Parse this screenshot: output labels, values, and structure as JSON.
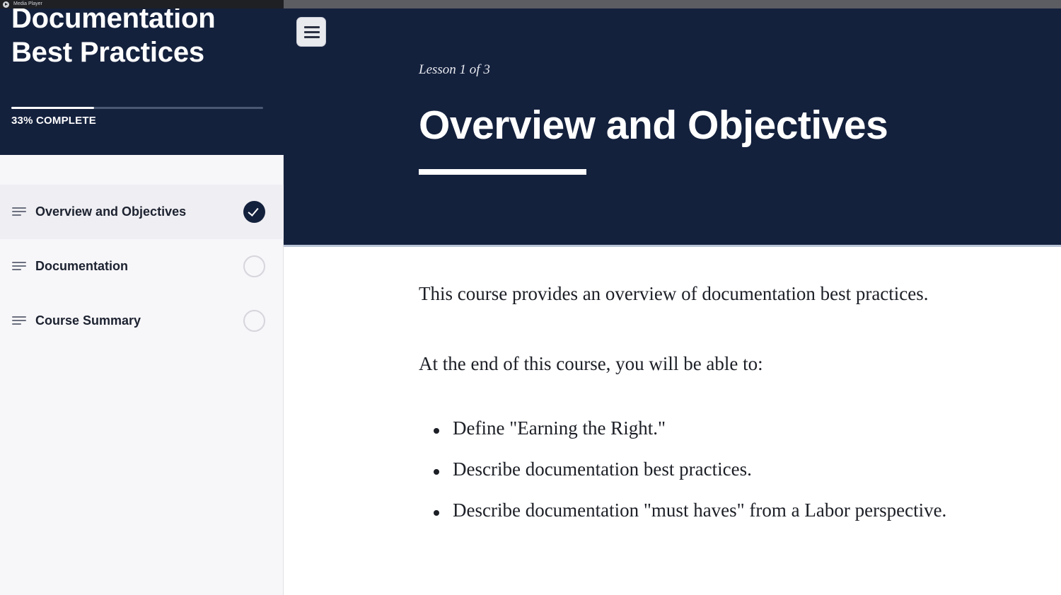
{
  "media_player": {
    "title": "Media Player"
  },
  "sidebar": {
    "course_title": "Documentation Best Practices",
    "progress": {
      "percent": 33,
      "label": "33% COMPLETE"
    },
    "lessons": [
      {
        "label": "Overview and Objectives",
        "status": "complete",
        "active": true
      },
      {
        "label": "Documentation",
        "status": "incomplete",
        "active": false
      },
      {
        "label": "Course Summary",
        "status": "incomplete",
        "active": false
      }
    ]
  },
  "main": {
    "menu_icon": "hamburger-icon",
    "lesson_counter": "Lesson 1 of 3",
    "lesson_title": "Overview and Objectives",
    "intro": "This course provides an overview of documentation best practices.",
    "lead": "At the end of this course, you will be able to:",
    "objectives": [
      "Define \"Earning the Right.\"",
      "Describe documentation best practices.",
      "Describe documentation \"must haves\" from a Labor perspective."
    ]
  },
  "colors": {
    "navy": "#14213d",
    "sidebar_bg": "#f7f6f9",
    "text": "#1c1f26"
  }
}
